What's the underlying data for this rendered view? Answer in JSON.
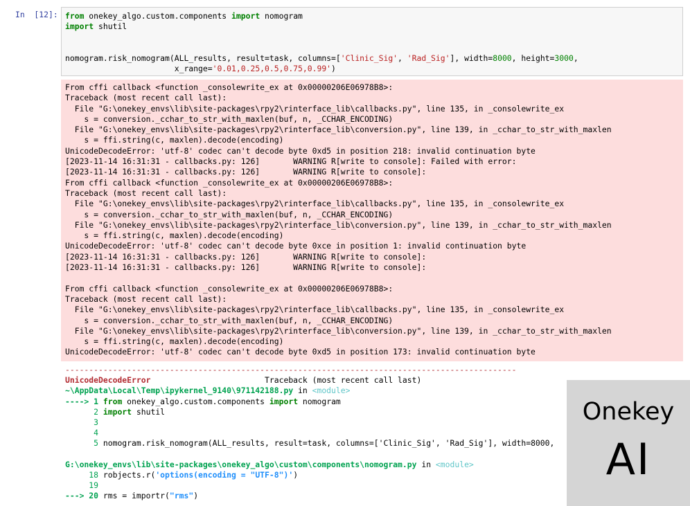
{
  "cell": {
    "prompt": "In  [12]:",
    "code": {
      "l1_kw1": "from",
      "l1_mod": " onekey_algo.custom.components ",
      "l1_kw2": "import",
      "l1_name": " nomogram",
      "l2_kw": "import",
      "l2_name": " shutil",
      "l5_a": "nomogram.risk_nomogram(ALL_results, result=task, columns=[",
      "l5_s1": "'Clinic_Sig'",
      "l5_b": ", ",
      "l5_s2": "'Rad_Sig'",
      "l5_c": "], width=",
      "l5_n1": "8000",
      "l5_d": ", height=",
      "l5_n2": "3000",
      "l5_e": ",",
      "l6_a": "                       x_range=",
      "l6_s": "'0.01,0.25,0.5,0.75,0.99'",
      "l6_b": ")"
    }
  },
  "stderr_lines": [
    "From cffi callback <function _consolewrite_ex at 0x00000206E06978B8>:",
    "Traceback (most recent call last):",
    "  File \"G:\\onekey_envs\\lib\\site-packages\\rpy2\\rinterface_lib\\callbacks.py\", line 135, in _consolewrite_ex",
    "    s = conversion._cchar_to_str_with_maxlen(buf, n, _CCHAR_ENCODING)",
    "  File \"G:\\onekey_envs\\lib\\site-packages\\rpy2\\rinterface_lib\\conversion.py\", line 139, in _cchar_to_str_with_maxlen",
    "    s = ffi.string(c, maxlen).decode(encoding)",
    "UnicodeDecodeError: 'utf-8' codec can't decode byte 0xd5 in position 218: invalid continuation byte",
    "[2023-11-14 16:31:31 - callbacks.py: 126]       WARNING R[write to console]: Failed with error:",
    "[2023-11-14 16:31:31 - callbacks.py: 126]       WARNING R[write to console]:",
    "From cffi callback <function _consolewrite_ex at 0x00000206E06978B8>:",
    "Traceback (most recent call last):",
    "  File \"G:\\onekey_envs\\lib\\site-packages\\rpy2\\rinterface_lib\\callbacks.py\", line 135, in _consolewrite_ex",
    "    s = conversion._cchar_to_str_with_maxlen(buf, n, _CCHAR_ENCODING)",
    "  File \"G:\\onekey_envs\\lib\\site-packages\\rpy2\\rinterface_lib\\conversion.py\", line 139, in _cchar_to_str_with_maxlen",
    "    s = ffi.string(c, maxlen).decode(encoding)",
    "UnicodeDecodeError: 'utf-8' codec can't decode byte 0xce in position 1: invalid continuation byte",
    "[2023-11-14 16:31:31 - callbacks.py: 126]       WARNING R[write to console]:",
    "[2023-11-14 16:31:31 - callbacks.py: 126]       WARNING R[write to console]:",
    "",
    "From cffi callback <function _consolewrite_ex at 0x00000206E06978B8>:",
    "Traceback (most recent call last):",
    "  File \"G:\\onekey_envs\\lib\\site-packages\\rpy2\\rinterface_lib\\callbacks.py\", line 135, in _consolewrite_ex",
    "    s = conversion._cchar_to_str_with_maxlen(buf, n, _CCHAR_ENCODING)",
    "  File \"G:\\onekey_envs\\lib\\site-packages\\rpy2\\rinterface_lib\\conversion.py\", line 139, in _cchar_to_str_with_maxlen",
    "    s = ffi.string(c, maxlen).decode(encoding)",
    "UnicodeDecodeError: 'utf-8' codec can't decode byte 0xd5 in position 173: invalid continuation byte"
  ],
  "traceback": {
    "dashes": "-----------------------------------------------------------------------------------------------",
    "error_name": "UnicodeDecodeError",
    "tb_header": "                        Traceback (most recent call last)",
    "file1_path": "~\\AppData\\Local\\Temp\\ipykernel_9140\\971142188.py",
    "file1_in": " in ",
    "module": "<module>",
    "f1_l1_arrow": "----> 1 ",
    "f1_l1_kw1": "from",
    "f1_l1_mod": " onekey_algo.custom.components ",
    "f1_l1_kw2": "import",
    "f1_l1_name": " nomogram",
    "f1_l2_no": "      2 ",
    "f1_l2_kw": "import",
    "f1_l2_name": " shutil",
    "f1_l3_no": "      3",
    "f1_l4_no": "      4",
    "f1_l5_no": "      5 ",
    "f1_l5_code": "nomogram.risk_nomogram(ALL_results, result=task, columns=['Clinic_Sig', 'Rad_Sig'], width=8000,",
    "file2_path": "G:\\onekey_envs\\lib\\site-packages\\onekey_algo\\custom\\components\\nomogram.py",
    "file2_in": " in ",
    "f2_l18_no": "     18 ",
    "f2_l18_a": "robjects.r(",
    "f2_l18_s": "'options(encoding = \"UTF-8\")'",
    "f2_l18_b": ")",
    "f2_l19_no": "     19",
    "f2_l20_arrow": "---> 20 ",
    "f2_l20_a": "rms = importr(",
    "f2_l20_s": "\"rms\"",
    "f2_l20_b": ")"
  },
  "watermark": {
    "top": "Onekey",
    "bottom": "AI",
    "bg_color": "#d5d5d5"
  },
  "colors": {
    "stderr_bg": "#fddddd",
    "input_bg": "#f7f7f7",
    "prompt": "#303f9f",
    "keyword": "#008000",
    "string": "#ba2121",
    "traceback_red": "#b22b31",
    "traceback_green": "#00a250"
  }
}
